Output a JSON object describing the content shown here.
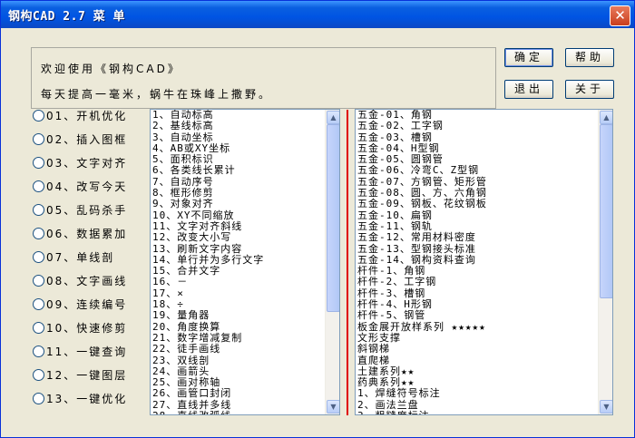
{
  "window": {
    "title": "钢构CAD 2.7  菜 单",
    "close_label": "✕"
  },
  "welcome": {
    "line1": "欢迎使用《钢构CAD》",
    "line2": "每天提高一毫米，蜗牛在珠峰上撒野。"
  },
  "buttons": {
    "ok": "确定",
    "help": "帮助",
    "exit": "退出",
    "about": "关于"
  },
  "radios": [
    "01、开机优化",
    "02、插入图框",
    "03、文字对齐",
    "04、改写今天",
    "05、乱码杀手",
    "06、数据累加",
    "07、单线剖",
    "08、文字画线",
    "09、连续编号",
    "10、快速修剪",
    "11、一键查询",
    "12、一键图层",
    "13、一键优化"
  ],
  "left_list": [
    "1、自动标高",
    "2、基线标高",
    "3、自动坐标",
    "4、AB或XY坐标",
    "5、面积标识",
    "6、各类线长累计",
    "7、自动序号",
    "8、框形修剪",
    "9、对象对齐",
    "10、XY不同缩放",
    "11、文字对齐斜线",
    "12、改变大小写",
    "13、刷新文字内容",
    "14、单行并为多行文字",
    "15、合并文字",
    "16、－",
    "17、×",
    "18、÷",
    "19、量角器",
    "20、角度换算",
    "21、数字增减复制",
    "22、徒手画线",
    "23、双线剖",
    "24、画箭头",
    "25、画对称轴",
    "26、画管口封闭",
    "27、直线并多线",
    "28、直线改弧线"
  ],
  "right_list": [
    "五金-01、角钢",
    "五金-02、工字钢",
    "五金-03、槽钢",
    "五金-04、H型钢",
    "五金-05、圆钢管",
    "五金-06、冷弯C、Z型钢",
    "五金-07、方钢管、矩形管",
    "五金-08、圆、方、六角钢",
    "五金-09、钢板、花纹钢板",
    "五金-10、扁钢",
    "五金-11、钢轨",
    "五金-12、常用材料密度",
    "五金-13、型钢接头标准",
    "五金-14、钢构资料查询",
    "   杆件-1、角钢",
    "   杆件-2、工字钢",
    "   杆件-3、槽钢",
    "   杆件-4、H形钢",
    "   杆件-5、钢管",
    "板金展开放样系列 ★★★★★",
    "   文形支撑",
    "   斜钢梯",
    "   直爬梯",
    "土建系列★★",
    "药典系列★★",
    "1、焊缝符号标注",
    "2、画法兰盘",
    "3、粗糙度标注"
  ]
}
